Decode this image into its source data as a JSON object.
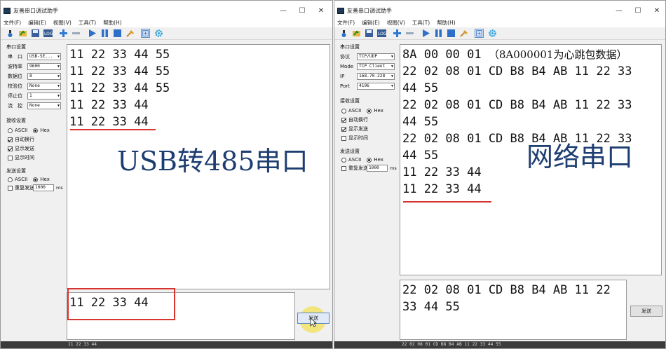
{
  "colors": {
    "accent_red": "#d8332f",
    "overlay_blue": "#1e3e72",
    "send_highlight": "#f3e36a"
  },
  "left": {
    "title": "友善串口调试助手",
    "window_controls": [
      "—",
      "☐",
      "✕"
    ],
    "menu": [
      "文件(F)",
      "编辑(E)",
      "视图(V)",
      "工具(T)",
      "帮助(H)"
    ],
    "settings": {
      "group": "串口设置",
      "rows": [
        {
          "label": "串　口",
          "value": "USB-SE..."
        },
        {
          "label": "波特率",
          "value": "9600"
        },
        {
          "label": "数据位",
          "value": "8"
        },
        {
          "label": "校验位",
          "value": "None"
        },
        {
          "label": "停止位",
          "value": "1"
        },
        {
          "label": "流　控",
          "value": "None"
        }
      ]
    },
    "receive": {
      "group": "接收设置",
      "ascii": "ASCII",
      "hex": "Hex",
      "auto_wrap": "自动换行",
      "show_send": "显示发送",
      "show_time": "显示时间"
    },
    "send": {
      "group": "发送设置",
      "ascii": "ASCII",
      "hex": "Hex",
      "repeat": "重复发送",
      "interval": "1000",
      "unit": "ms"
    },
    "rx_lines": [
      "11 22 33 44 55",
      "11 22 33 44 55",
      "11 22 33 44 55",
      "11 22 33 44",
      "11 22 33 44"
    ],
    "overlay": "USB转485串口",
    "tx_text": "11 22 33 44",
    "send_button": "发送",
    "status": "11 22 33 44"
  },
  "right": {
    "title": "友善串口调试助手",
    "window_controls": [
      "—",
      "☐",
      "✕"
    ],
    "menu": [
      "文件(F)",
      "编辑(E)",
      "视图(V)",
      "工具(T)",
      "帮助(H)"
    ],
    "settings": {
      "group": "串口设置",
      "rows": [
        {
          "label": "协议",
          "value": "TCP/UDP"
        },
        {
          "label": "Mode",
          "value": "TCP Client"
        },
        {
          "label": "IP",
          "value": "168.70.228"
        },
        {
          "label": "Port",
          "value": "4196"
        }
      ]
    },
    "receive": {
      "group": "接收设置",
      "ascii": "ASCII",
      "hex": "Hex",
      "auto_wrap": "自动换行",
      "show_send": "显示发送",
      "show_time": "显示时间"
    },
    "send": {
      "group": "发送设置",
      "ascii": "ASCII",
      "hex": "Hex",
      "repeat": "重复发送",
      "interval": "1000",
      "unit": "ms"
    },
    "rx_first": "8A 00 00 01",
    "rx_note": "（8A000001为心跳包数据）",
    "rx_lines": [
      "22 02 08 01 CD B8 B4 AB 11 22 33",
      "44 55",
      "22 02 08 01 CD B8 B4 AB 11 22 33",
      "44 55",
      "22 02 08 01 CD B8 B4 AB 11 22 33",
      "44 55",
      "11 22 33 44",
      "11 22 33 44"
    ],
    "overlay": "网络串口",
    "tx_lines": [
      "22 02 08 01 CD B8 B4 AB 11 22",
      "33 44 55"
    ],
    "send_button": "发送",
    "status": "22 02 08 01 CD B8 B4 AB 11 22 33 44 55"
  }
}
